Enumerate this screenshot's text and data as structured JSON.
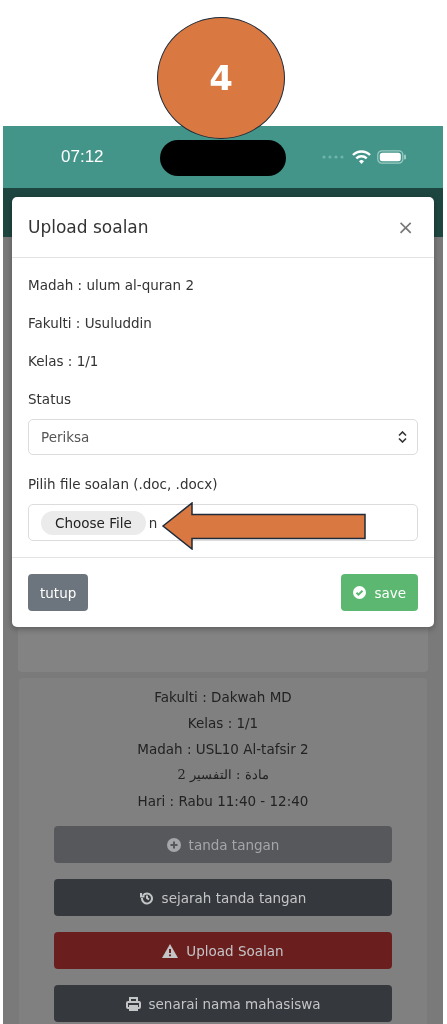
{
  "annotation": {
    "number": "4"
  },
  "status_bar": {
    "time": "07:12"
  },
  "modal": {
    "title": "Upload soalan",
    "close": "×",
    "info": [
      "Madah : ulum al-quran 2",
      "Fakulti : Usuluddin",
      "Kelas : 1/1"
    ],
    "status": {
      "label": "Status",
      "value": "Periksa"
    },
    "file": {
      "label": "Pilih file soalan (.doc, .docx)",
      "button": "Choose File",
      "file_name": "n"
    },
    "buttons": [
      {
        "label": "tutup",
        "kind": "secondary"
      },
      {
        "label": "save",
        "kind": "success"
      }
    ]
  },
  "class_card": {
    "lines": [
      {
        "text": "Fakulti : Dakwah MD",
        "kind": "latin"
      },
      {
        "text": "Kelas : 1/1",
        "kind": "latin"
      },
      {
        "text": "Madah : USL10 Al-tafsir 2",
        "kind": "latin"
      },
      {
        "text": "مادة : التفسير 2",
        "kind": "arabic"
      },
      {
        "text": "Hari : Rabu 11:40 - 12:40",
        "kind": "latin"
      }
    ],
    "buttons": [
      {
        "label": "tanda tangan",
        "kind": "secondary",
        "disabled": true
      },
      {
        "label": "sejarah tanda tangan",
        "kind": "dark",
        "disabled": false
      },
      {
        "label": "Upload Soalan",
        "kind": "danger",
        "disabled": false
      },
      {
        "label": "senarai nama mahasiswa",
        "kind": "dark",
        "disabled": false
      }
    ]
  }
}
